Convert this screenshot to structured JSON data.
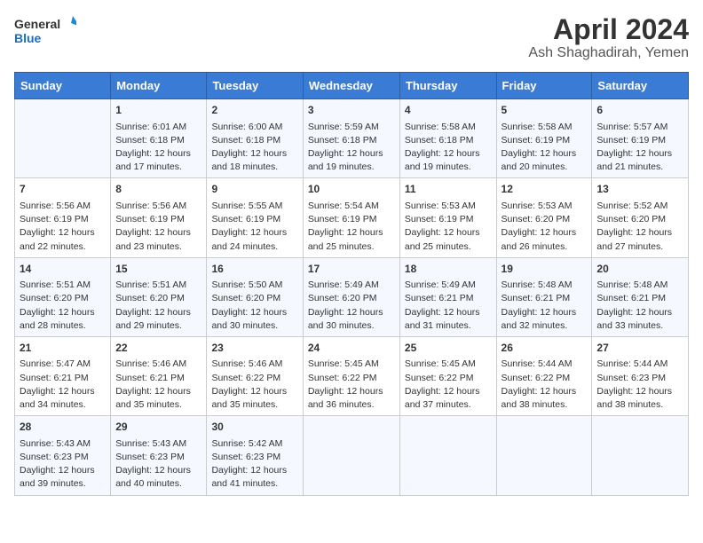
{
  "logo": {
    "general": "General",
    "blue": "Blue"
  },
  "title": "April 2024",
  "subtitle": "Ash Shaghadirah, Yemen",
  "headers": [
    "Sunday",
    "Monday",
    "Tuesday",
    "Wednesday",
    "Thursday",
    "Friday",
    "Saturday"
  ],
  "weeks": [
    [
      {
        "day": "",
        "content": ""
      },
      {
        "day": "1",
        "content": "Sunrise: 6:01 AM\nSunset: 6:18 PM\nDaylight: 12 hours\nand 17 minutes."
      },
      {
        "day": "2",
        "content": "Sunrise: 6:00 AM\nSunset: 6:18 PM\nDaylight: 12 hours\nand 18 minutes."
      },
      {
        "day": "3",
        "content": "Sunrise: 5:59 AM\nSunset: 6:18 PM\nDaylight: 12 hours\nand 19 minutes."
      },
      {
        "day": "4",
        "content": "Sunrise: 5:58 AM\nSunset: 6:18 PM\nDaylight: 12 hours\nand 19 minutes."
      },
      {
        "day": "5",
        "content": "Sunrise: 5:58 AM\nSunset: 6:19 PM\nDaylight: 12 hours\nand 20 minutes."
      },
      {
        "day": "6",
        "content": "Sunrise: 5:57 AM\nSunset: 6:19 PM\nDaylight: 12 hours\nand 21 minutes."
      }
    ],
    [
      {
        "day": "7",
        "content": "Sunrise: 5:56 AM\nSunset: 6:19 PM\nDaylight: 12 hours\nand 22 minutes."
      },
      {
        "day": "8",
        "content": "Sunrise: 5:56 AM\nSunset: 6:19 PM\nDaylight: 12 hours\nand 23 minutes."
      },
      {
        "day": "9",
        "content": "Sunrise: 5:55 AM\nSunset: 6:19 PM\nDaylight: 12 hours\nand 24 minutes."
      },
      {
        "day": "10",
        "content": "Sunrise: 5:54 AM\nSunset: 6:19 PM\nDaylight: 12 hours\nand 25 minutes."
      },
      {
        "day": "11",
        "content": "Sunrise: 5:53 AM\nSunset: 6:19 PM\nDaylight: 12 hours\nand 25 minutes."
      },
      {
        "day": "12",
        "content": "Sunrise: 5:53 AM\nSunset: 6:20 PM\nDaylight: 12 hours\nand 26 minutes."
      },
      {
        "day": "13",
        "content": "Sunrise: 5:52 AM\nSunset: 6:20 PM\nDaylight: 12 hours\nand 27 minutes."
      }
    ],
    [
      {
        "day": "14",
        "content": "Sunrise: 5:51 AM\nSunset: 6:20 PM\nDaylight: 12 hours\nand 28 minutes."
      },
      {
        "day": "15",
        "content": "Sunrise: 5:51 AM\nSunset: 6:20 PM\nDaylight: 12 hours\nand 29 minutes."
      },
      {
        "day": "16",
        "content": "Sunrise: 5:50 AM\nSunset: 6:20 PM\nDaylight: 12 hours\nand 30 minutes."
      },
      {
        "day": "17",
        "content": "Sunrise: 5:49 AM\nSunset: 6:20 PM\nDaylight: 12 hours\nand 30 minutes."
      },
      {
        "day": "18",
        "content": "Sunrise: 5:49 AM\nSunset: 6:21 PM\nDaylight: 12 hours\nand 31 minutes."
      },
      {
        "day": "19",
        "content": "Sunrise: 5:48 AM\nSunset: 6:21 PM\nDaylight: 12 hours\nand 32 minutes."
      },
      {
        "day": "20",
        "content": "Sunrise: 5:48 AM\nSunset: 6:21 PM\nDaylight: 12 hours\nand 33 minutes."
      }
    ],
    [
      {
        "day": "21",
        "content": "Sunrise: 5:47 AM\nSunset: 6:21 PM\nDaylight: 12 hours\nand 34 minutes."
      },
      {
        "day": "22",
        "content": "Sunrise: 5:46 AM\nSunset: 6:21 PM\nDaylight: 12 hours\nand 35 minutes."
      },
      {
        "day": "23",
        "content": "Sunrise: 5:46 AM\nSunset: 6:22 PM\nDaylight: 12 hours\nand 35 minutes."
      },
      {
        "day": "24",
        "content": "Sunrise: 5:45 AM\nSunset: 6:22 PM\nDaylight: 12 hours\nand 36 minutes."
      },
      {
        "day": "25",
        "content": "Sunrise: 5:45 AM\nSunset: 6:22 PM\nDaylight: 12 hours\nand 37 minutes."
      },
      {
        "day": "26",
        "content": "Sunrise: 5:44 AM\nSunset: 6:22 PM\nDaylight: 12 hours\nand 38 minutes."
      },
      {
        "day": "27",
        "content": "Sunrise: 5:44 AM\nSunset: 6:23 PM\nDaylight: 12 hours\nand 38 minutes."
      }
    ],
    [
      {
        "day": "28",
        "content": "Sunrise: 5:43 AM\nSunset: 6:23 PM\nDaylight: 12 hours\nand 39 minutes."
      },
      {
        "day": "29",
        "content": "Sunrise: 5:43 AM\nSunset: 6:23 PM\nDaylight: 12 hours\nand 40 minutes."
      },
      {
        "day": "30",
        "content": "Sunrise: 5:42 AM\nSunset: 6:23 PM\nDaylight: 12 hours\nand 41 minutes."
      },
      {
        "day": "",
        "content": ""
      },
      {
        "day": "",
        "content": ""
      },
      {
        "day": "",
        "content": ""
      },
      {
        "day": "",
        "content": ""
      }
    ]
  ]
}
